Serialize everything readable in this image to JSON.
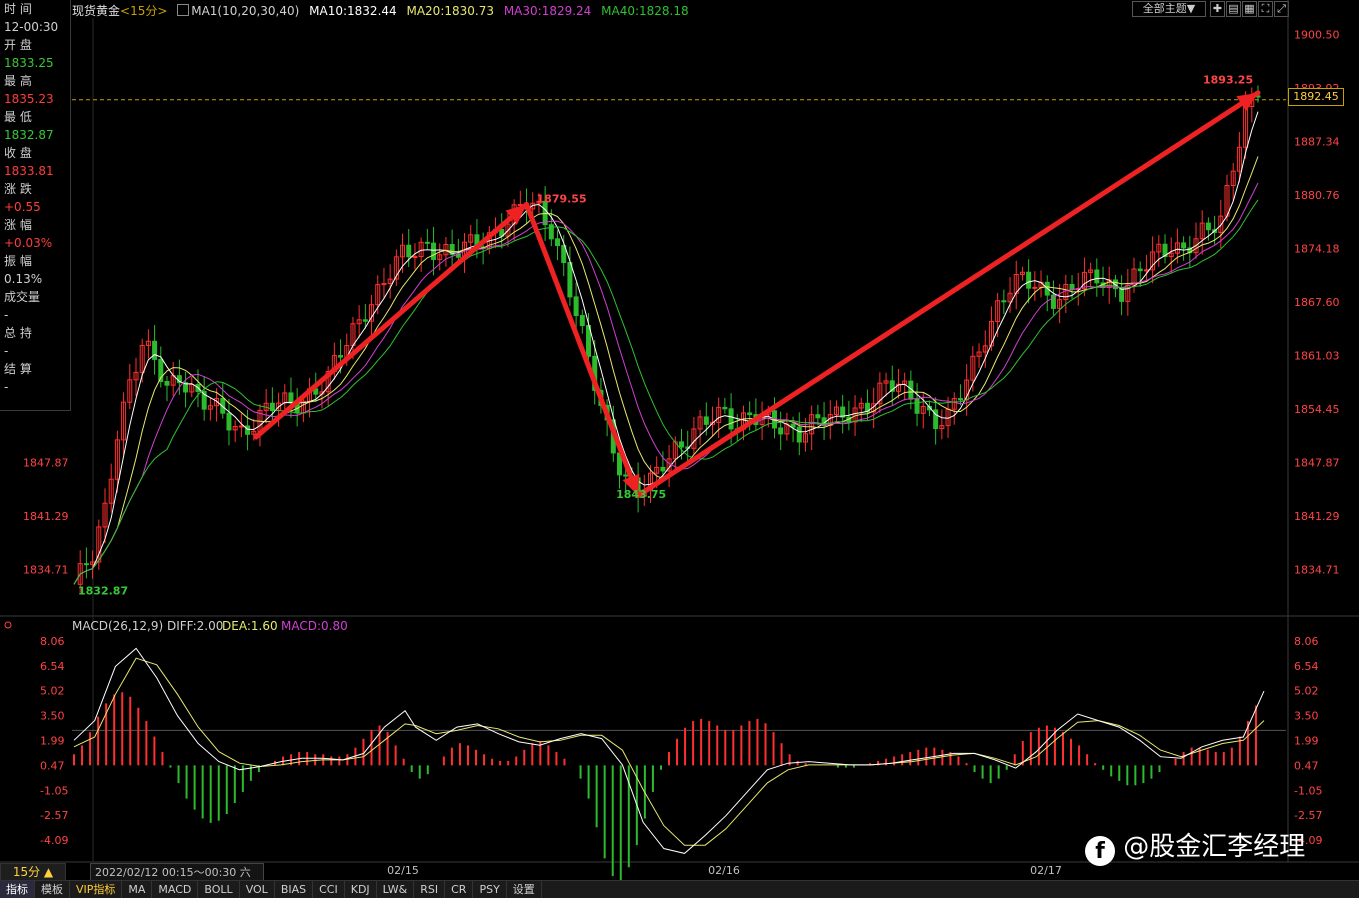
{
  "header": {
    "instrument": "现货黄金",
    "period_tag": "<15分>",
    "ma_label": "MA1(10,20,30,40)",
    "ma10": "MA10:1832.44",
    "ma20": "MA20:1830.73",
    "ma30": "MA30:1829.24",
    "ma40": "MA40:1828.18",
    "theme_button": "全部主题▼"
  },
  "info_panel": [
    {
      "label": "时 间",
      "value": "12-00:30",
      "color": "white"
    },
    {
      "label": "开 盘",
      "value": "1833.25",
      "color": "green"
    },
    {
      "label": "最 高",
      "value": "1835.23",
      "color": "red"
    },
    {
      "label": "最 低",
      "value": "1832.87",
      "color": "green"
    },
    {
      "label": "收 盘",
      "value": "1833.81",
      "color": "red"
    },
    {
      "label": "涨 跌",
      "value": "+0.55",
      "color": "red"
    },
    {
      "label": "涨 幅",
      "value": "+0.03%",
      "color": "red"
    },
    {
      "label": "振 幅",
      "value": "0.13%",
      "color": "white"
    },
    {
      "label": "成交量",
      "value": "-",
      "color": "white"
    },
    {
      "label": "总 持",
      "value": "-",
      "color": "white"
    },
    {
      "label": "结 算",
      "value": "-",
      "color": "white"
    }
  ],
  "chart_data": [
    {
      "type": "line",
      "subtype": "candlestick",
      "title": "现货黄金 15分",
      "y_ticks_right": [
        "1900.50",
        "1893.92",
        "1887.34",
        "1880.76",
        "1874.18",
        "1867.60",
        "1861.03",
        "1854.45",
        "1847.87",
        "1841.29",
        "1834.71"
      ],
      "y_ticks_left": [
        "1847.87",
        "1841.29",
        "1834.71"
      ],
      "ylim": [
        1829.5,
        1902.5
      ],
      "x_labels": [
        "02/15",
        "02/16",
        "02/17"
      ],
      "current_price": "1892.45",
      "annotations": [
        {
          "text": "1832.87",
          "kind": "low"
        },
        {
          "text": "1879.55",
          "kind": "high"
        },
        {
          "text": "1843.75",
          "kind": "low"
        },
        {
          "text": "1893.25",
          "kind": "high"
        }
      ],
      "series": [
        {
          "name": "MA10",
          "color": "#ffffff"
        },
        {
          "name": "MA20",
          "color": "#e8e870"
        },
        {
          "name": "MA30",
          "color": "#d040d0"
        },
        {
          "name": "MA40",
          "color": "#30c030"
        }
      ],
      "price_path": [
        [
          0,
          1832.9
        ],
        [
          3,
          1836
        ],
        [
          5,
          1842
        ],
        [
          7,
          1852
        ],
        [
          9,
          1858
        ],
        [
          11,
          1862
        ],
        [
          13,
          1860
        ],
        [
          15,
          1857
        ],
        [
          17,
          1859
        ],
        [
          19,
          1857
        ],
        [
          21,
          1855
        ],
        [
          23,
          1854
        ],
        [
          25,
          1853
        ],
        [
          27,
          1852
        ],
        [
          29,
          1853
        ],
        [
          31,
          1854
        ],
        [
          33,
          1855
        ],
        [
          35,
          1855
        ],
        [
          37,
          1856
        ],
        [
          39,
          1857
        ],
        [
          41,
          1858
        ],
        [
          43,
          1861
        ],
        [
          45,
          1864
        ],
        [
          47,
          1867
        ],
        [
          49,
          1869
        ],
        [
          51,
          1871
        ],
        [
          53,
          1873
        ],
        [
          55,
          1874
        ],
        [
          57,
          1875
        ],
        [
          59,
          1874
        ],
        [
          61,
          1873
        ],
        [
          63,
          1874
        ],
        [
          65,
          1875
        ],
        [
          67,
          1876
        ],
        [
          69,
          1877
        ],
        [
          71,
          1878
        ],
        [
          73,
          1879.5
        ],
        [
          75,
          1879
        ],
        [
          77,
          1877
        ],
        [
          79,
          1872
        ],
        [
          81,
          1866
        ],
        [
          83,
          1860
        ],
        [
          85,
          1855
        ],
        [
          87,
          1850
        ],
        [
          89,
          1846
        ],
        [
          91,
          1844
        ],
        [
          93,
          1845
        ],
        [
          95,
          1848
        ],
        [
          97,
          1850
        ],
        [
          99,
          1851
        ],
        [
          101,
          1852
        ],
        [
          103,
          1853
        ],
        [
          105,
          1854
        ],
        [
          107,
          1853
        ],
        [
          109,
          1854
        ],
        [
          111,
          1853
        ],
        [
          113,
          1852
        ],
        [
          115,
          1852
        ],
        [
          117,
          1852
        ],
        [
          119,
          1853
        ],
        [
          121,
          1853
        ],
        [
          123,
          1853
        ],
        [
          125,
          1854
        ],
        [
          127,
          1855
        ],
        [
          129,
          1856
        ],
        [
          131,
          1857
        ],
        [
          133,
          1857
        ],
        [
          135,
          1856
        ],
        [
          137,
          1855
        ],
        [
          139,
          1853
        ],
        [
          141,
          1853
        ],
        [
          143,
          1856
        ],
        [
          145,
          1860
        ],
        [
          147,
          1864
        ],
        [
          149,
          1867
        ],
        [
          151,
          1869
        ],
        [
          153,
          1870
        ],
        [
          155,
          1870
        ],
        [
          157,
          1869
        ],
        [
          159,
          1868
        ],
        [
          161,
          1869
        ],
        [
          163,
          1870
        ],
        [
          165,
          1871
        ],
        [
          167,
          1870
        ],
        [
          169,
          1869
        ],
        [
          171,
          1870
        ],
        [
          173,
          1872
        ],
        [
          175,
          1874
        ],
        [
          177,
          1875
        ],
        [
          179,
          1874
        ],
        [
          181,
          1875
        ],
        [
          183,
          1876
        ],
        [
          185,
          1878
        ],
        [
          187,
          1885
        ],
        [
          189,
          1891
        ],
        [
          191,
          1893.2
        ]
      ],
      "trend_arrows": [
        {
          "from": [
            1851.0,
            1851.0
          ],
          "to": [
            1879.6,
            1879.6
          ],
          "label": "up"
        },
        {
          "from": [
            1879.6,
            1879.6
          ],
          "to": [
            1843.8,
            1843.8
          ],
          "label": "down"
        },
        {
          "from": [
            1843.8,
            1843.8
          ],
          "to": [
            1893.3,
            1893.3
          ],
          "label": "up"
        }
      ]
    },
    {
      "type": "bar",
      "subtype": "macd",
      "title": "MACD(26,12,9)",
      "diff_label": "DIFF:2.00",
      "dea_label": "DEA:1.60",
      "macd_label": "MACD:0.80",
      "y_ticks": [
        "8.06",
        "6.54",
        "5.02",
        "3.50",
        "1.99",
        "0.47",
        "-1.05",
        "-2.57",
        "-4.09"
      ],
      "ylim": [
        -5.3,
        8.6
      ],
      "histogram": [
        0.5,
        0.9,
        1.5,
        2.2,
        2.8,
        3.2,
        3.3,
        3.1,
        2.6,
        2.0,
        1.3,
        0.6,
        -0.1,
        -0.8,
        -1.5,
        -2.0,
        -2.4,
        -2.6,
        -2.5,
        -2.2,
        -1.7,
        -1.2,
        -0.7,
        -0.3,
        0.0,
        0.2,
        0.4,
        0.5,
        0.6,
        0.6,
        0.5,
        0.5,
        0.4,
        0.4,
        0.5,
        0.8,
        1.2,
        1.6,
        1.8,
        1.5,
        0.9,
        0.3,
        -0.3,
        -0.6,
        -0.4,
        0.0,
        0.4,
        0.8,
        1.0,
        0.9,
        0.7,
        0.5,
        0.3,
        0.2,
        0.2,
        0.4,
        0.7,
        1.0,
        1.1,
        0.9,
        0.6,
        0.3,
        0.0,
        -0.6,
        -1.5,
        -2.8,
        -4.2,
        -5.0,
        -5.2,
        -4.6,
        -3.6,
        -2.4,
        -1.2,
        -0.2,
        0.6,
        1.2,
        1.7,
        2.0,
        2.1,
        2.0,
        1.8,
        1.6,
        1.6,
        1.8,
        2.0,
        2.1,
        1.9,
        1.5,
        1.0,
        0.5,
        0.2,
        0.1,
        0.0,
        0.0,
        0.0,
        -0.1,
        -0.1,
        -0.1,
        0.0,
        0.1,
        0.2,
        0.3,
        0.4,
        0.5,
        0.6,
        0.7,
        0.8,
        0.8,
        0.7,
        0.6,
        0.4,
        0.1,
        -0.3,
        -0.6,
        -0.8,
        -0.6,
        -0.2,
        0.5,
        1.1,
        1.5,
        1.7,
        1.8,
        1.7,
        1.5,
        1.2,
        0.9,
        0.5,
        0.1,
        -0.2,
        -0.5,
        -0.7,
        -0.9,
        -0.9,
        -0.8,
        -0.6,
        -0.3,
        0.0,
        0.3,
        0.6,
        0.8,
        0.8,
        0.7,
        0.6,
        0.6,
        0.8,
        1.3,
        2.0,
        2.7
      ],
      "diff_path": [
        [
          0,
          2.0
        ],
        [
          4,
          3.2
        ],
        [
          8,
          6.5
        ],
        [
          12,
          7.6
        ],
        [
          16,
          5.8
        ],
        [
          20,
          3.5
        ],
        [
          24,
          1.8
        ],
        [
          28,
          0.7
        ],
        [
          32,
          0.2
        ],
        [
          36,
          0.4
        ],
        [
          40,
          0.7
        ],
        [
          44,
          0.9
        ],
        [
          48,
          0.9
        ],
        [
          52,
          0.8
        ],
        [
          56,
          1.2
        ],
        [
          60,
          2.8
        ],
        [
          64,
          3.8
        ],
        [
          66,
          2.8
        ],
        [
          70,
          2.0
        ],
        [
          74,
          2.8
        ],
        [
          78,
          3.0
        ],
        [
          82,
          2.4
        ],
        [
          86,
          1.9
        ],
        [
          90,
          1.7
        ],
        [
          94,
          2.1
        ],
        [
          98,
          2.4
        ],
        [
          102,
          2.1
        ],
        [
          106,
          0.5
        ],
        [
          110,
          -3.0
        ],
        [
          114,
          -4.6
        ],
        [
          118,
          -4.9
        ],
        [
          122,
          -3.8
        ],
        [
          126,
          -2.6
        ],
        [
          130,
          -1.2
        ],
        [
          134,
          0.2
        ],
        [
          138,
          0.6
        ],
        [
          142,
          0.7
        ],
        [
          146,
          0.6
        ],
        [
          150,
          0.5
        ],
        [
          154,
          0.5
        ],
        [
          158,
          0.6
        ],
        [
          162,
          0.8
        ],
        [
          166,
          1.0
        ],
        [
          170,
          1.2
        ],
        [
          174,
          1.2
        ],
        [
          178,
          0.8
        ],
        [
          182,
          0.3
        ],
        [
          186,
          1.3
        ],
        [
          190,
          2.6
        ],
        [
          194,
          3.6
        ],
        [
          198,
          3.2
        ],
        [
          202,
          2.8
        ],
        [
          206,
          2.0
        ],
        [
          210,
          1.0
        ],
        [
          214,
          0.9
        ],
        [
          218,
          1.6
        ],
        [
          222,
          2.0
        ],
        [
          226,
          2.2
        ],
        [
          230,
          5.0
        ]
      ],
      "dea_path": [
        [
          0,
          1.6
        ],
        [
          4,
          2.2
        ],
        [
          8,
          4.8
        ],
        [
          12,
          7.0
        ],
        [
          16,
          6.6
        ],
        [
          20,
          4.8
        ],
        [
          24,
          2.8
        ],
        [
          28,
          1.3
        ],
        [
          32,
          0.6
        ],
        [
          36,
          0.4
        ],
        [
          40,
          0.5
        ],
        [
          44,
          0.7
        ],
        [
          48,
          0.8
        ],
        [
          52,
          0.8
        ],
        [
          56,
          1.0
        ],
        [
          60,
          2.0
        ],
        [
          64,
          3.0
        ],
        [
          66,
          2.9
        ],
        [
          70,
          2.4
        ],
        [
          74,
          2.6
        ],
        [
          78,
          2.9
        ],
        [
          82,
          2.7
        ],
        [
          86,
          2.2
        ],
        [
          90,
          1.9
        ],
        [
          94,
          2.0
        ],
        [
          98,
          2.3
        ],
        [
          102,
          2.3
        ],
        [
          106,
          1.4
        ],
        [
          110,
          -1.0
        ],
        [
          114,
          -3.2
        ],
        [
          118,
          -4.4
        ],
        [
          122,
          -4.4
        ],
        [
          126,
          -3.4
        ],
        [
          130,
          -2.0
        ],
        [
          134,
          -0.6
        ],
        [
          138,
          0.2
        ],
        [
          142,
          0.5
        ],
        [
          146,
          0.5
        ],
        [
          150,
          0.5
        ],
        [
          154,
          0.5
        ],
        [
          158,
          0.6
        ],
        [
          162,
          0.7
        ],
        [
          166,
          0.9
        ],
        [
          170,
          1.1
        ],
        [
          174,
          1.2
        ],
        [
          178,
          0.9
        ],
        [
          182,
          0.5
        ],
        [
          186,
          1.0
        ],
        [
          190,
          2.1
        ],
        [
          194,
          3.1
        ],
        [
          198,
          3.2
        ],
        [
          202,
          2.9
        ],
        [
          206,
          2.3
        ],
        [
          210,
          1.4
        ],
        [
          214,
          1.0
        ],
        [
          218,
          1.4
        ],
        [
          222,
          1.8
        ],
        [
          226,
          2.0
        ],
        [
          230,
          3.2
        ]
      ]
    }
  ],
  "footer": {
    "period_button": "15分 ▲",
    "datetime": "2022/02/12 00:15～00:30 六"
  },
  "toolbar_tabs": [
    "指标",
    "模板",
    "VIP指标",
    "MA",
    "MACD",
    "BOLL",
    "VOL",
    "BIAS",
    "CCI",
    "KDJ",
    "LW&",
    "RSI",
    "CR",
    "PSY",
    "设置"
  ],
  "watermark": "@股金汇李经理"
}
